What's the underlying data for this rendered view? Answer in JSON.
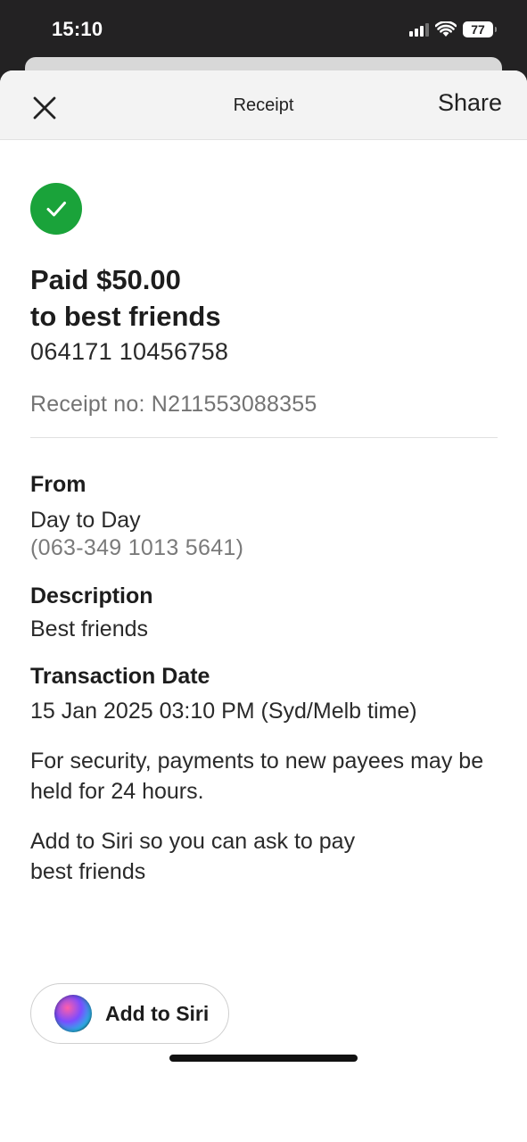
{
  "status_bar": {
    "time": "15:10",
    "battery": "77",
    "icons": [
      "signal-icon",
      "wifi-icon",
      "battery-icon"
    ]
  },
  "nav": {
    "title": "Receipt",
    "share_label": "Share",
    "close_icon": "close-icon"
  },
  "receipt": {
    "status_icon": "check-circle-icon",
    "status_color": "#1aa33a",
    "paid_line": "Paid $50.00",
    "to_line": "to best friends",
    "account_number": "064171 10456758",
    "receipt_number": "Receipt no: N211553088355"
  },
  "from": {
    "label": "From",
    "account_name": "Day to Day",
    "account_number": "(063-349 1013 5641)"
  },
  "description": {
    "label": "Description",
    "value": "Best friends"
  },
  "transaction_date": {
    "label": "Transaction Date",
    "value": "15 Jan 2025 03:10 PM (Syd/Melb time)"
  },
  "notices": {
    "security": "For security, payments to new payees may be held for 24 hours.",
    "siri_prompt": "Add to Siri so you can ask to pay best friends"
  },
  "siri_button": {
    "label": "Add to Siri",
    "icon": "siri-icon"
  }
}
